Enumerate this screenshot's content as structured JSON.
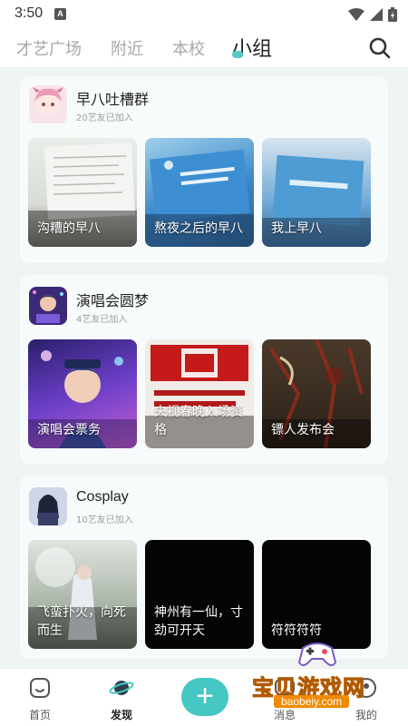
{
  "status_bar": {
    "time": "3:50",
    "notification_glyph": "A"
  },
  "top_tabs": [
    {
      "label": "才艺广场"
    },
    {
      "label": "附近"
    },
    {
      "label": "本校"
    },
    {
      "label": "小组"
    }
  ],
  "active_tab_index": 3,
  "accent_color": "#45c8c4",
  "groups": [
    {
      "name": "早八吐槽群",
      "count": "20艺友已加入",
      "posts": [
        {
          "caption": "沟糟的早八"
        },
        {
          "caption": "熬夜之后的早八"
        },
        {
          "caption": "我上早八"
        }
      ]
    },
    {
      "name": "演唱会圆梦",
      "count": "4艺友已加入",
      "posts": [
        {
          "caption": "演唱会票务"
        },
        {
          "caption": "央视春晚入场资格"
        },
        {
          "caption": "镖人发布会"
        }
      ]
    },
    {
      "name": "Cosplay",
      "count": "10艺友已加入",
      "posts": [
        {
          "caption": "飞蛮扑火，向死而生"
        },
        {
          "caption": "神州有一仙，寸劲可开天"
        },
        {
          "caption": "符符符符"
        }
      ]
    }
  ],
  "bottom_nav": [
    {
      "label": "首页",
      "icon": "home-icon"
    },
    {
      "label": "发现",
      "icon": "planet-icon"
    },
    {
      "label": "消息",
      "icon": "message-icon"
    },
    {
      "label": "我的",
      "icon": "profile-icon"
    }
  ],
  "watermark": {
    "text": "宝贝游戏网",
    "url": "baobeiy.com"
  }
}
